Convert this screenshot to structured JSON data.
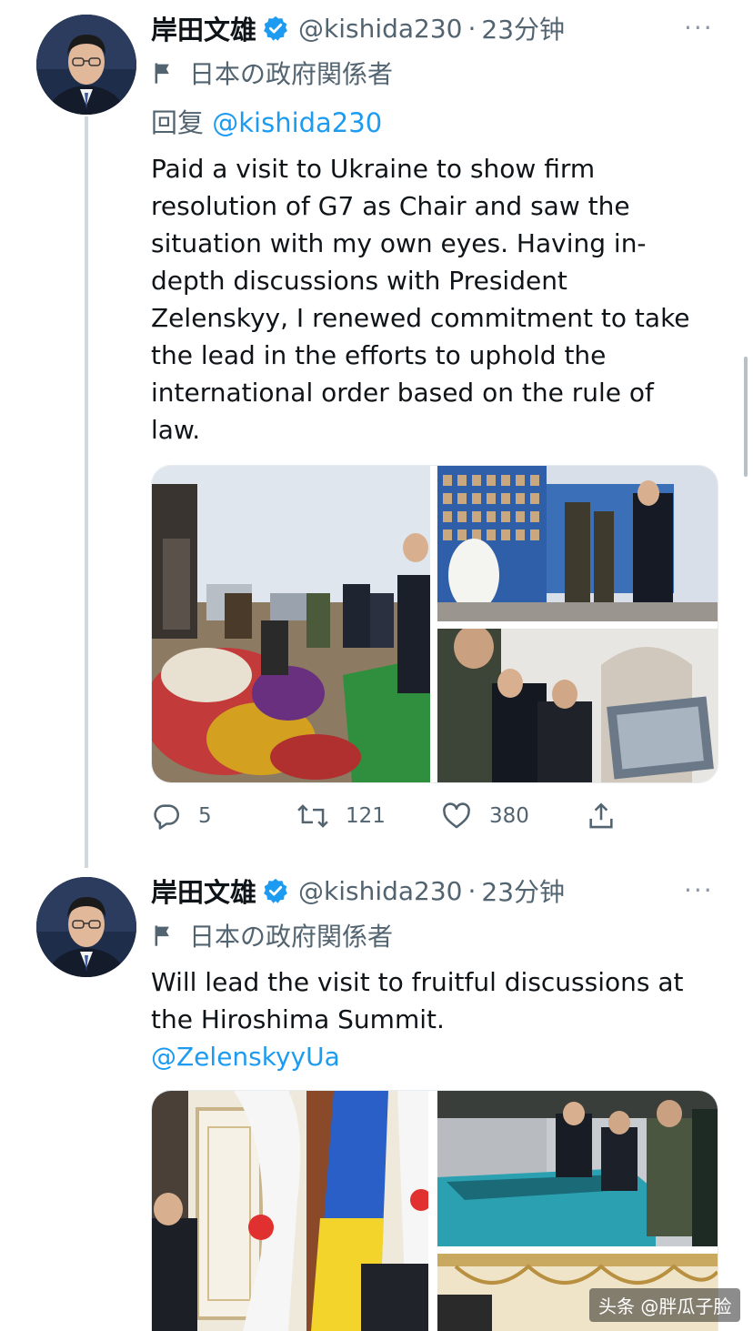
{
  "tweets": [
    {
      "author_name": "岸田文雄",
      "handle": "@kishida230",
      "separator": "·",
      "time": "23分钟",
      "more": "···",
      "affiliation": "日本の政府関係者",
      "reply_prefix": "回复",
      "reply_handle": "@kishida230",
      "text_lines": [
        "Paid a visit to Ukraine to show firm",
        "resolution of G7 as Chair and saw the",
        "situation with my own eyes. Having in-",
        "depth discussions with President",
        "Zelenskyy, I renewed commitment to take",
        "the lead in the efforts to uphold the",
        "international order based on the rule of",
        "law."
      ],
      "replies": "5",
      "retweets": "121",
      "likes": "380"
    },
    {
      "author_name": "岸田文雄",
      "handle": "@kishida230",
      "separator": "·",
      "time": "23分钟",
      "more": "···",
      "affiliation": "日本の政府関係者",
      "text_lines": [
        "Will lead the visit to fruitful discussions at",
        "the Hiroshima Summit."
      ],
      "mention": "@ZelenskyyUa"
    }
  ],
  "watermark": "头条 @胖瓜子脸",
  "colors": {
    "accent": "#1d9bf0",
    "secondary_text": "#536471",
    "thread_line": "#cfd9de"
  }
}
